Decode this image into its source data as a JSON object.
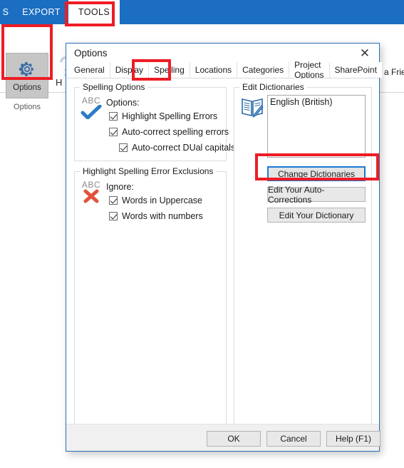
{
  "ribbon": {
    "tabs": [
      {
        "label": "S",
        "active": false
      },
      {
        "label": "EXPORT",
        "active": false
      },
      {
        "label": "TOOLS",
        "active": true
      }
    ],
    "options_button": {
      "label": "Options",
      "icon": "gear-icon"
    },
    "group_label": "Options",
    "help_label": "H",
    "right_text": "l a Frie",
    "icons": [
      "help-question-icon",
      "globe-icon",
      "letter-h-icon",
      "window-icon",
      "chevron-down-icon"
    ]
  },
  "dialog": {
    "title": "Options",
    "close_icon": "close-icon",
    "tabs": [
      {
        "label": "General",
        "active": false
      },
      {
        "label": "Display",
        "active": false
      },
      {
        "label": "Spelling",
        "active": true
      },
      {
        "label": "Locations",
        "active": false
      },
      {
        "label": "Categories",
        "active": false
      },
      {
        "label": "Project Options",
        "active": false
      },
      {
        "label": "SharePoint",
        "active": false
      }
    ],
    "spelling_options": {
      "group_label": "Spelling Options",
      "icon_text": "ABC",
      "icon_mark": "check-mark-icon",
      "sub_label": "Options:",
      "checkboxes": [
        {
          "label": "Highlight Spelling Errors",
          "checked": true
        },
        {
          "label": "Auto-correct spelling errors",
          "checked": true
        },
        {
          "label": "Auto-correct DUal capitals",
          "checked": true
        }
      ]
    },
    "exclusions": {
      "group_label": "Highlight Spelling Error Exclusions",
      "icon_text": "ABC",
      "icon_mark": "cross-mark-icon",
      "sub_label": "Ignore:",
      "checkboxes": [
        {
          "label": "Words in Uppercase",
          "checked": true
        },
        {
          "label": "Words with numbers",
          "checked": true
        }
      ]
    },
    "edit_dictionaries": {
      "group_label": "Edit Dictionaries",
      "icon": "dictionary-book-icon",
      "list_items": [
        "English (British)"
      ],
      "buttons": [
        {
          "label": "Change Dictionaries",
          "focused": true
        },
        {
          "label": "Edit Your Auto-Corrections",
          "focused": false
        },
        {
          "label": "Edit Your Dictionary",
          "focused": false
        }
      ]
    },
    "footer_buttons": [
      {
        "label": "OK"
      },
      {
        "label": "Cancel"
      },
      {
        "label": "Help (F1)"
      }
    ]
  },
  "annotations": {
    "highlight_color": "#ee1c25",
    "boxes": [
      "tools-tab-highlight",
      "options-button-highlight",
      "spelling-tab-highlight",
      "change-dictionaries-highlight"
    ]
  },
  "colors": {
    "ribbon_blue": "#1b6ec2",
    "dialog_border": "#2a6fb8",
    "check_blue": "#2b7cc4",
    "cross_red": "#e2533c"
  }
}
